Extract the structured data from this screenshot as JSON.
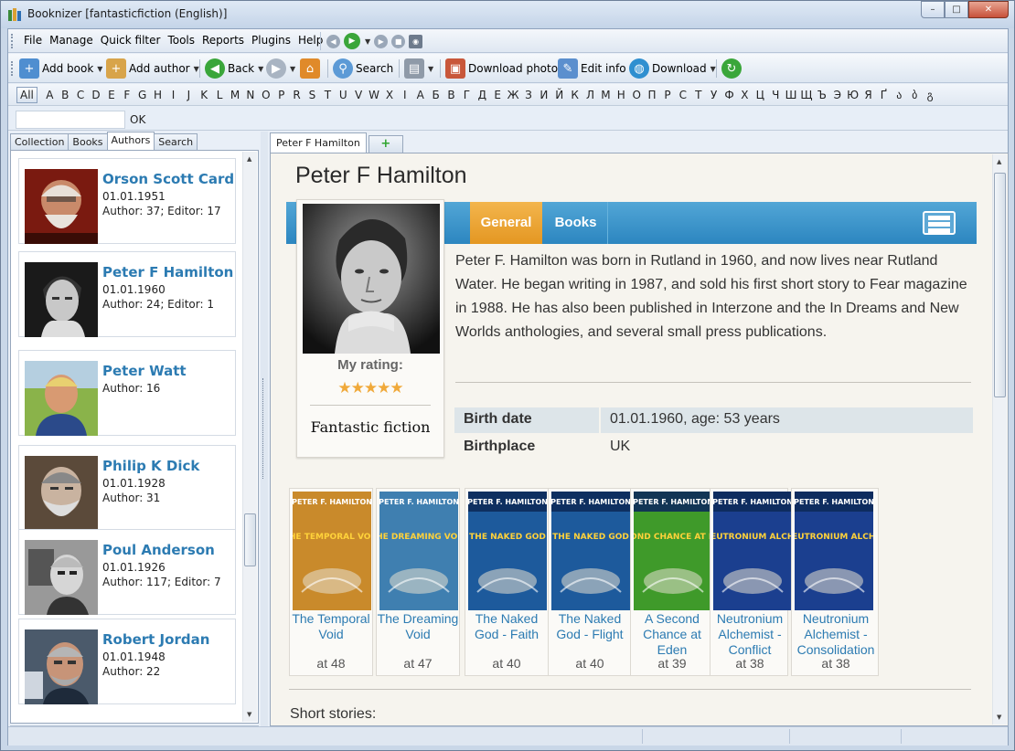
{
  "window": {
    "title": "Booknizer [fantasticfiction (English)]",
    "min": "–",
    "max": "□",
    "close": "✕"
  },
  "menu": [
    "File",
    "Manage",
    "Quick filter",
    "Tools",
    "Reports",
    "Plugins",
    "Help"
  ],
  "toolbar": {
    "add_book": "Add book",
    "add_author": "Add author",
    "back": "Back",
    "search": "Search",
    "download_photo": "Download photo",
    "edit_info": "Edit info",
    "download": "Download"
  },
  "alphabet": [
    "All",
    "A",
    "B",
    "C",
    "D",
    "E",
    "F",
    "G",
    "H",
    "I",
    "J",
    "K",
    "L",
    "M",
    "N",
    "O",
    "P",
    "R",
    "S",
    "T",
    "U",
    "V",
    "W",
    "X",
    "I",
    "А",
    "Б",
    "В",
    "Г",
    "Д",
    "Е",
    "Ж",
    "З",
    "И",
    "Й",
    "К",
    "Л",
    "М",
    "Н",
    "О",
    "П",
    "Р",
    "С",
    "Т",
    "У",
    "Ф",
    "Х",
    "Ц",
    "Ч",
    "Ш",
    "Щ",
    "Ъ",
    "Э",
    "Ю",
    "Я",
    "Ґ",
    "ა",
    "ბ",
    "გ"
  ],
  "filter": {
    "value": "",
    "ok": "OK"
  },
  "left_tabs": [
    "Collection",
    "Books",
    "Authors",
    "Search"
  ],
  "left_active_tab": "Authors",
  "authors": [
    {
      "name": "Orson Scott Card",
      "date": "01.01.1951",
      "count": "Author: 37; Editor: 17"
    },
    {
      "name": "Peter F Hamilton",
      "date": "01.01.1960",
      "count": "Author: 24; Editor: 1"
    },
    {
      "name": "Peter Watt",
      "date": "",
      "count": "Author: 16"
    },
    {
      "name": "Philip K Dick",
      "date": "01.01.1928",
      "count": "Author: 31"
    },
    {
      "name": "Poul Anderson",
      "date": "01.01.1926",
      "count": "Author: 117; Editor: 7"
    },
    {
      "name": "Robert Jordan",
      "date": "01.01.1948",
      "count": "Author: 22"
    }
  ],
  "doc_tab": "Peter F Hamilton",
  "detail": {
    "name": "Peter F Hamilton",
    "tabs": {
      "general": "General",
      "books": "Books"
    },
    "rating_label": "My rating:",
    "stars": "★★★★★",
    "rating": 5,
    "source_logo": "Fantastic fiction",
    "bio": "Peter F. Hamilton was born in Rutland in 1960, and now lives near Rutland Water. He began writing in 1987, and sold his first short story to Fear magazine in 1988. He has also been published in Interzone and the In Dreams and New Worlds anthologies, and several small press publications.",
    "info": [
      {
        "key": "Birth date",
        "value": "01.01.1960, age: 53 years"
      },
      {
        "key": "Birthplace",
        "value": "UK"
      }
    ],
    "books": [
      {
        "title": "The Temporal Void",
        "at": "at 48",
        "cover_author": "PETER F. HAMILTON",
        "cover_title": "THE TEMPORAL VOID",
        "bg": "#c98a2b"
      },
      {
        "title": "The Dreaming Void",
        "at": "at 47",
        "cover_author": "PETER F. HAMILTON",
        "cover_title": "THE DREAMING VOID",
        "bg": "#3f7fb0"
      },
      {
        "title": "The Naked God - Faith",
        "at": "at 40",
        "cover_author": "PETER F. HAMILTON",
        "cover_title": "THE NAKED GOD",
        "bg": "#1d5a9c"
      },
      {
        "title": "The Naked God - Flight",
        "at": "at 40",
        "cover_author": "PETER F. HAMILTON",
        "cover_title": "THE NAKED GOD",
        "bg": "#1d5a9c"
      },
      {
        "title": "A Second Chance at Eden",
        "at": "at 39",
        "cover_author": "PETER F. HAMILTON",
        "cover_title": "SECOND CHANCE AT EDEN",
        "bg": "#3f9a2a"
      },
      {
        "title": "Neutronium Alchemist - Conflict",
        "at": "at 38",
        "cover_author": "PETER F. HAMILTON",
        "cover_title": "THE NEUTRONIUM ALCHEMIST",
        "bg": "#1b3f8f"
      },
      {
        "title": "Neutronium Alchemist - Consolidation",
        "at": "at 38",
        "cover_author": "PETER F. HAMILTON",
        "cover_title": "THE NEUTRONIUM ALCHEMIST",
        "bg": "#1b3f8f"
      }
    ],
    "short_stories_label": "Short stories:"
  }
}
